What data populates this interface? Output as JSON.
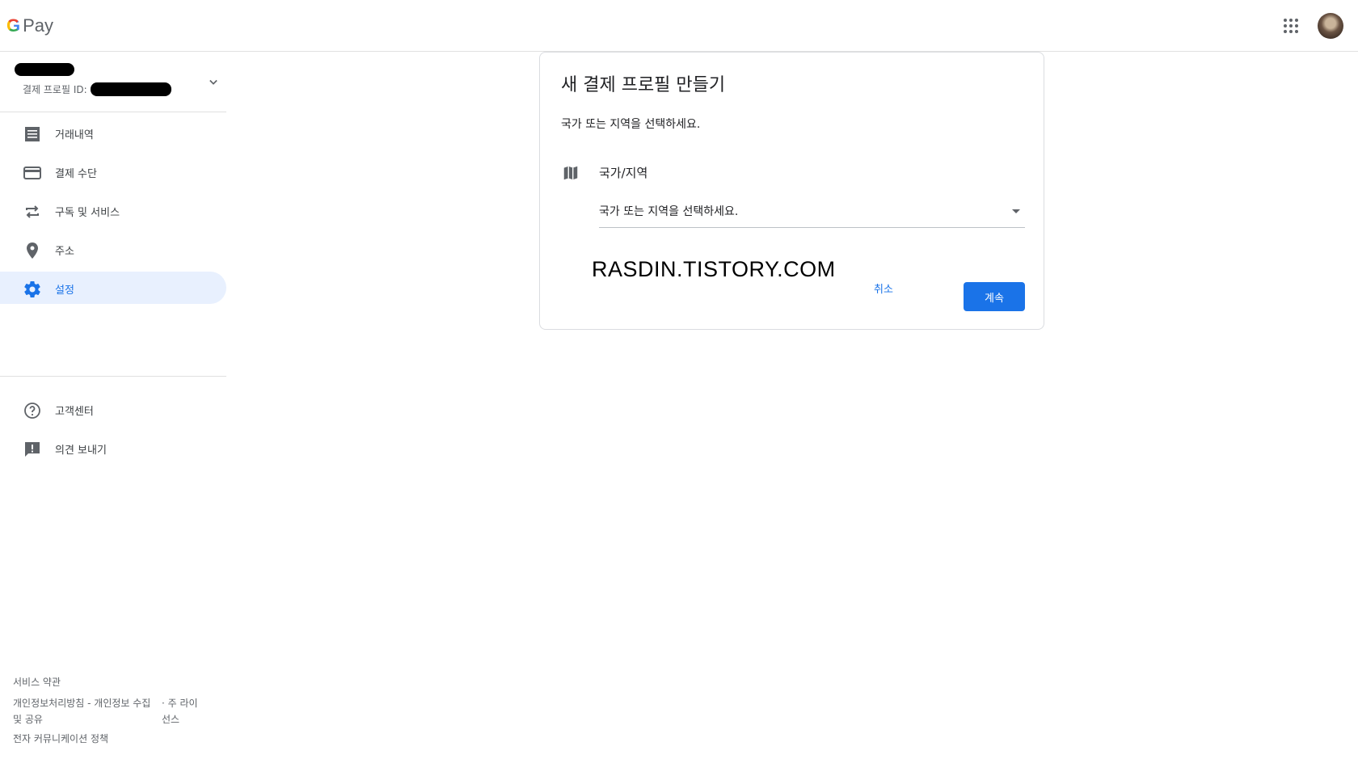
{
  "header": {
    "logo_g": "G",
    "logo_pay": "Pay",
    "apps_icon": "apps-grid-icon",
    "avatar_icon": "account-avatar"
  },
  "sidebar": {
    "profile": {
      "id_label": "결제 프로필 ID:",
      "chevron_icon": "chevron-down-icon"
    },
    "nav": [
      {
        "label": "거래내역",
        "icon": "receipt-list-icon"
      },
      {
        "label": "결제 수단",
        "icon": "credit-card-icon"
      },
      {
        "label": "구독 및 서비스",
        "icon": "repeat-icon"
      },
      {
        "label": "주소",
        "icon": "location-pin-icon"
      },
      {
        "label": "설정",
        "icon": "gear-icon",
        "active": true
      }
    ],
    "nav2": [
      {
        "label": "고객센터",
        "icon": "help-circle-icon"
      },
      {
        "label": "의견 보내기",
        "icon": "feedback-icon"
      }
    ],
    "footer": {
      "terms": "서비스 약관",
      "privacy_col1": "개인정보처리방침 - 개인정보 수집 및 공유",
      "privacy_col2": "· 주 라이선스",
      "comms": "전자 커뮤니케이션 정책"
    }
  },
  "dialog": {
    "title": "새 결제 프로필 만들기",
    "subtitle": "국가 또는 지역을 선택하세요.",
    "field_label": "국가/지역",
    "field_icon": "map-icon",
    "select_value": "국가 또는 지역을 선택하세요.",
    "watermark": "RASDIN.TISTORY.COM",
    "cancel_label": "취소",
    "continue_label": "계속"
  },
  "colors": {
    "accent": "#1a73e8",
    "active_bg": "#e8f0fe",
    "icon_gray": "#5f6368",
    "divider": "#e0e0e0"
  }
}
